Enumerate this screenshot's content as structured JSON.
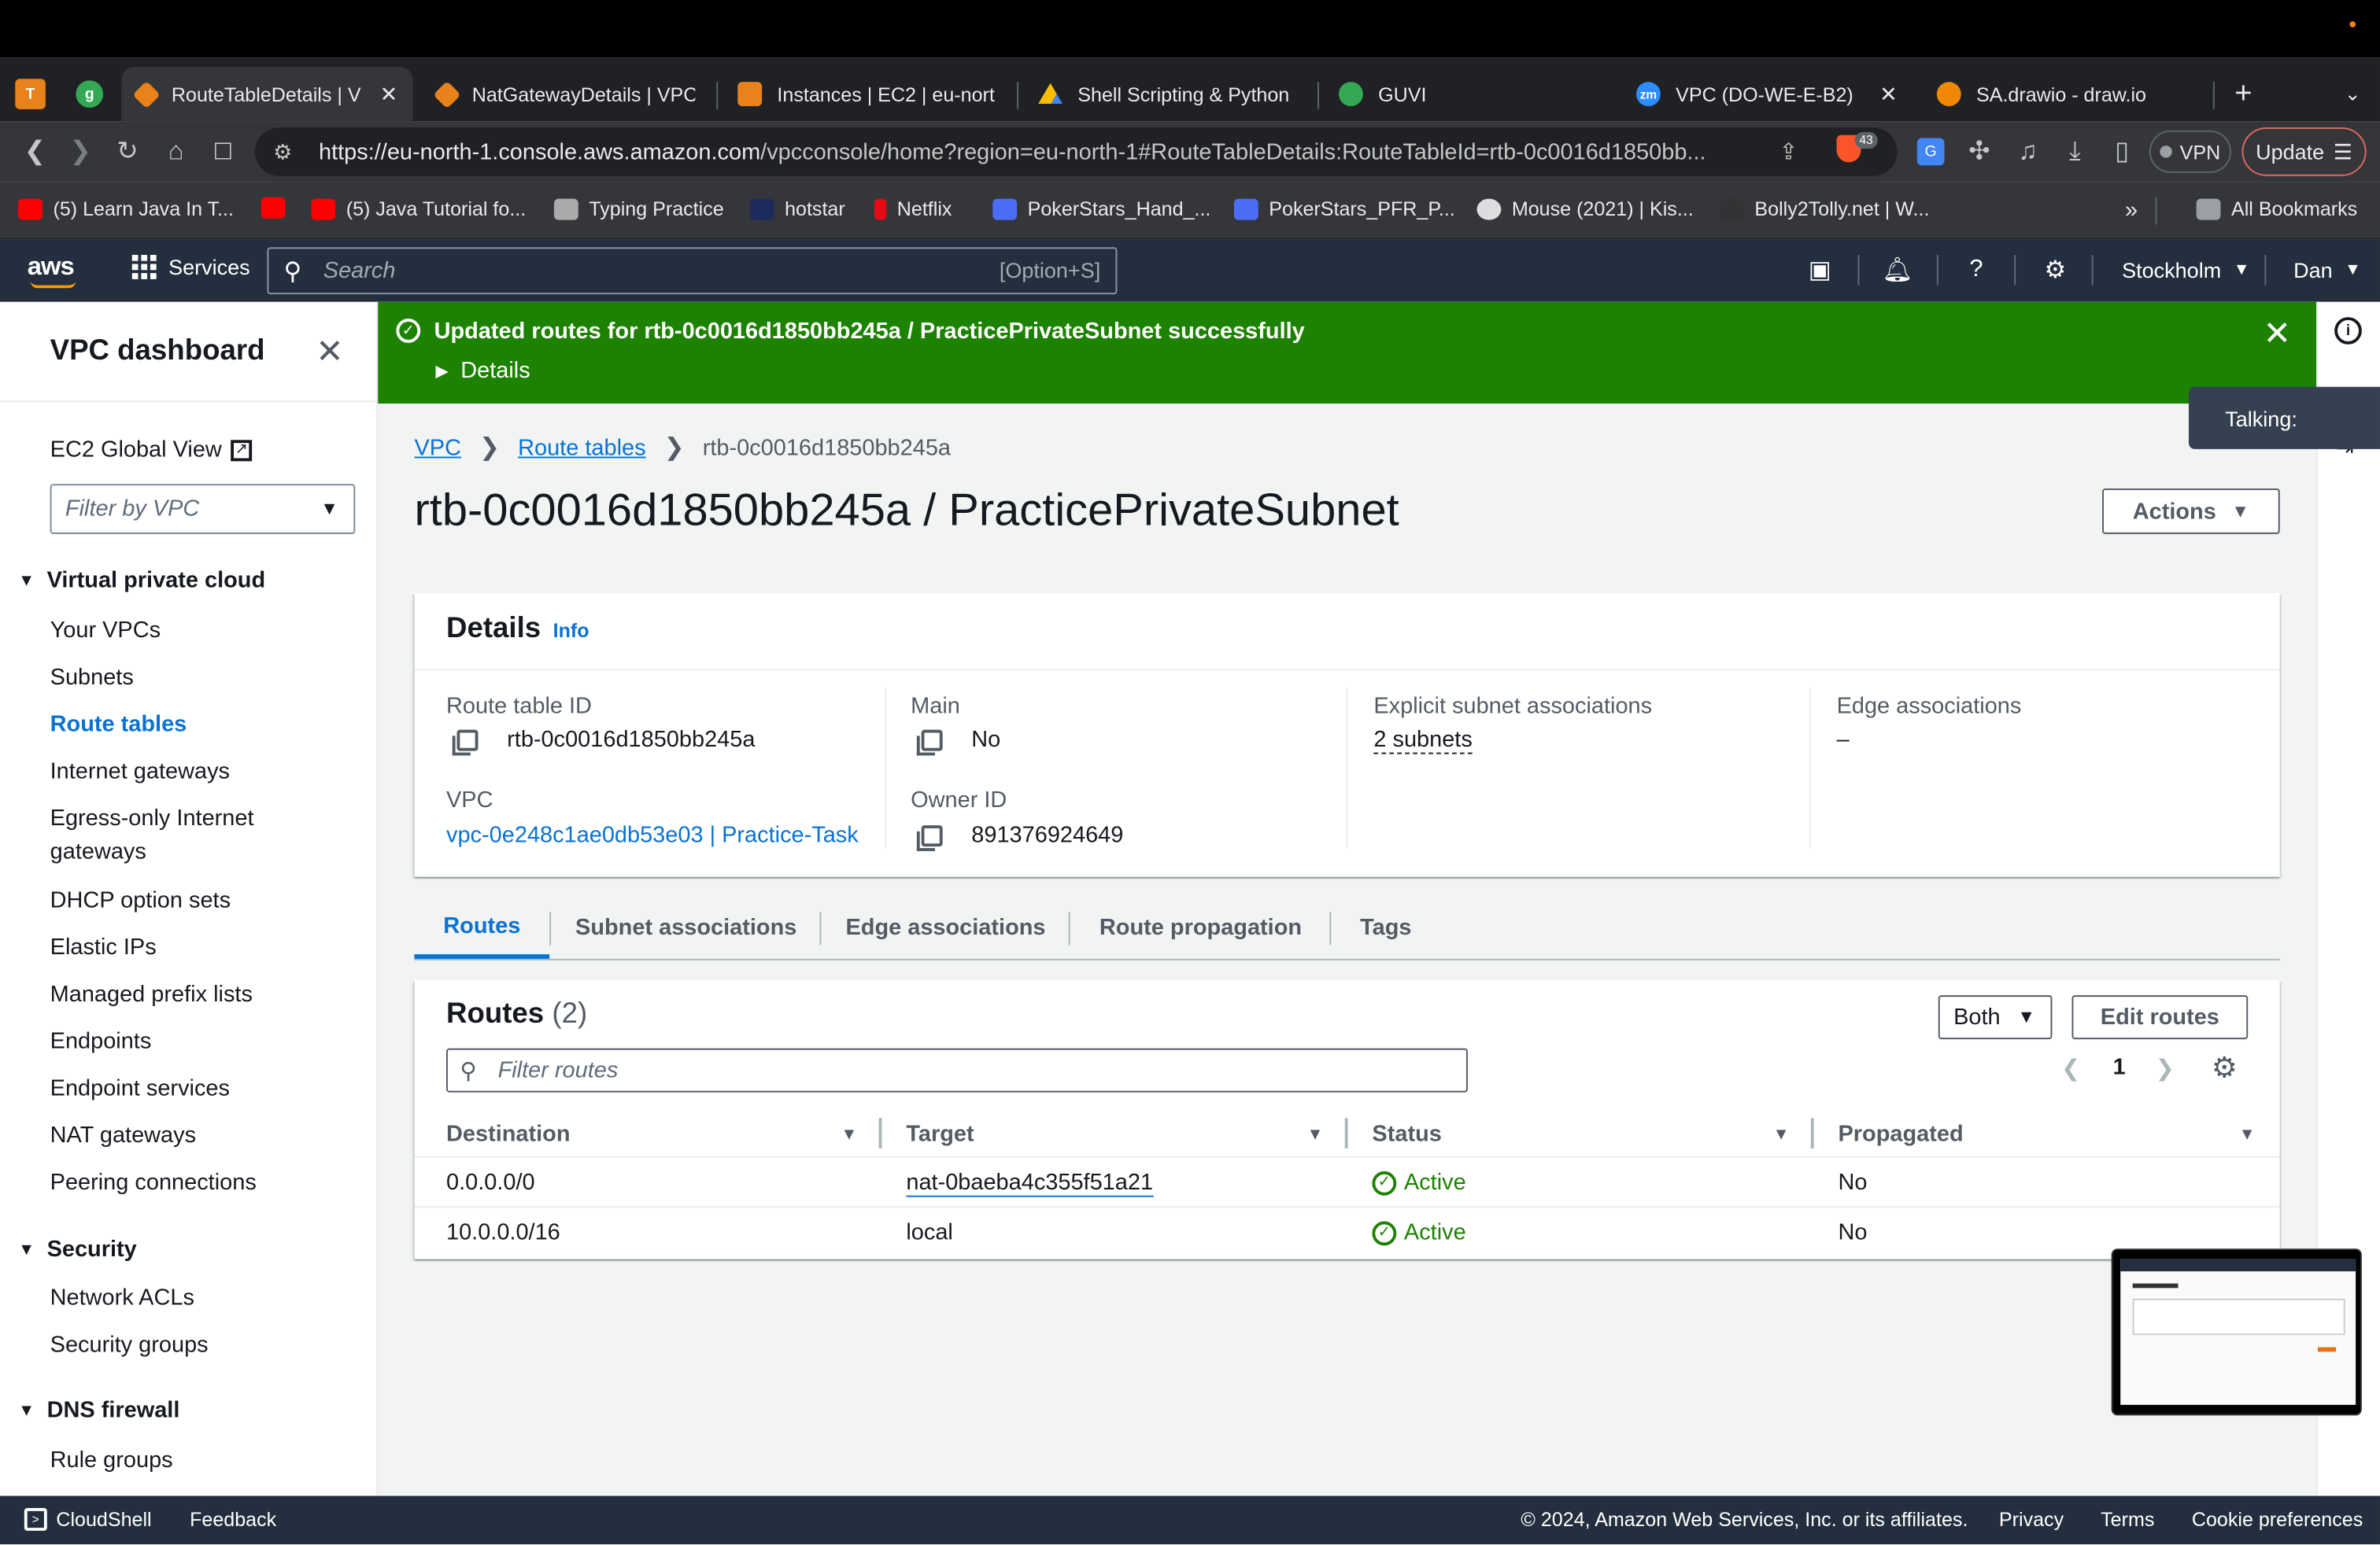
{
  "browser": {
    "tabs": [
      {
        "title": "RouteTableDetails | V",
        "active": true,
        "icon_color": "#e8821a"
      },
      {
        "title": "NatGatewayDetails | VPC",
        "icon_color": "#e8821a"
      },
      {
        "title": "Instances | EC2 | eu-nort",
        "icon_color": "#e8821a"
      },
      {
        "title": "Shell Scripting & Python",
        "icon_color": "#4285f4"
      },
      {
        "title": "GUVI",
        "icon_color": "#34a853"
      },
      {
        "title": "VPC (DO-WE-E-B2)",
        "icon_color": "#2d8cff",
        "icon_text": "zm"
      },
      {
        "title": "SA.drawio - draw.io",
        "icon_color": "#f08705"
      }
    ],
    "pinned": [
      {
        "letter": "T",
        "color": "#e8821a"
      },
      {
        "letter": "g",
        "color": "#34a853"
      }
    ],
    "url_host": "https://eu-north-1.console.aws.amazon.com",
    "url_path": "/vpcconsole/home?region=eu-north-1#RouteTableDetails:RouteTableId=rtb-0c0016d1850bb...",
    "shield_count": "43",
    "vpn_label": "VPN",
    "update_label": "Update",
    "bookmarks": [
      {
        "label": "(5) Learn Java In T...",
        "color": "#ff0000"
      },
      {
        "label": "",
        "color": "#ff0000"
      },
      {
        "label": "(5) Java Tutorial fo...",
        "color": "#ff0000"
      },
      {
        "label": "Typing Practice",
        "color": "#aaaaaa"
      },
      {
        "label": "hotstar",
        "color": "#1f2a5c"
      },
      {
        "label": "Netflix",
        "color": "#e50914"
      },
      {
        "label": "PokerStars_Hand_...",
        "color": "#4a6cf7"
      },
      {
        "label": "PokerStars_PFR_P...",
        "color": "#4a6cf7"
      },
      {
        "label": "Mouse (2021) | Kis...",
        "color": "#dddddd"
      },
      {
        "label": "Bolly2Tolly.net | W...",
        "color": "#333333"
      }
    ],
    "all_bookmarks": "All Bookmarks"
  },
  "aws_nav": {
    "logo": "aws",
    "services": "Services",
    "search_placeholder": "Search",
    "search_shortcut": "[Option+S]",
    "region": "Stockholm",
    "user": "Dan"
  },
  "sidebar": {
    "title": "VPC dashboard",
    "ec2_global_view": "EC2 Global View",
    "filter_placeholder": "Filter by VPC",
    "sections": [
      {
        "heading": "Virtual private cloud",
        "items": [
          "Your VPCs",
          "Subnets",
          "Route tables",
          "Internet gateways",
          "Egress-only Internet gateways",
          "DHCP option sets",
          "Elastic IPs",
          "Managed prefix lists",
          "Endpoints",
          "Endpoint services",
          "NAT gateways",
          "Peering connections"
        ]
      },
      {
        "heading": "Security",
        "items": [
          "Network ACLs",
          "Security groups"
        ]
      },
      {
        "heading": "DNS firewall",
        "items": [
          "Rule groups"
        ]
      }
    ],
    "active_item": "Route tables"
  },
  "flash": {
    "message": "Updated routes for rtb-0c0016d1850bb245a / PracticePrivateSubnet successfully",
    "details": "Details",
    "color": "#1d8102"
  },
  "breadcrumb": [
    "VPC",
    "Route tables",
    "rtb-0c0016d1850bb245a"
  ],
  "page_title": "rtb-0c0016d1850bb245a / PracticePrivateSubnet",
  "actions_label": "Actions",
  "details": {
    "heading": "Details",
    "info": "Info",
    "route_table_id_label": "Route table ID",
    "route_table_id": "rtb-0c0016d1850bb245a",
    "vpc_label": "VPC",
    "vpc_value": "vpc-0e248c1ae0db53e03 | Practice-Task",
    "main_label": "Main",
    "main_value": "No",
    "owner_label": "Owner ID",
    "owner_value": "891376924649",
    "explicit_label": "Explicit subnet associations",
    "explicit_value": "2 subnets",
    "edge_label": "Edge associations",
    "edge_value": "–"
  },
  "tabs": [
    "Routes",
    "Subnet associations",
    "Edge associations",
    "Route propagation",
    "Tags"
  ],
  "routes": {
    "heading": "Routes",
    "count": "(2)",
    "both_label": "Both",
    "edit_label": "Edit routes",
    "filter_placeholder": "Filter routes",
    "page": "1",
    "columns": [
      "Destination",
      "Target",
      "Status",
      "Propagated"
    ],
    "rows": [
      {
        "destination": "0.0.0.0/0",
        "target": "nat-0baeba4c355f51a21",
        "status": "Active",
        "propagated": "No"
      },
      {
        "destination": "10.0.0.0/16",
        "target": "local",
        "status": "Active",
        "propagated": "No"
      }
    ]
  },
  "talking": "Talking:",
  "footer": {
    "cloudshell": "CloudShell",
    "feedback": "Feedback",
    "copyright": "© 2024, Amazon Web Services, Inc. or its affiliates.",
    "privacy": "Privacy",
    "terms": "Terms",
    "cookie": "Cookie preferences"
  }
}
